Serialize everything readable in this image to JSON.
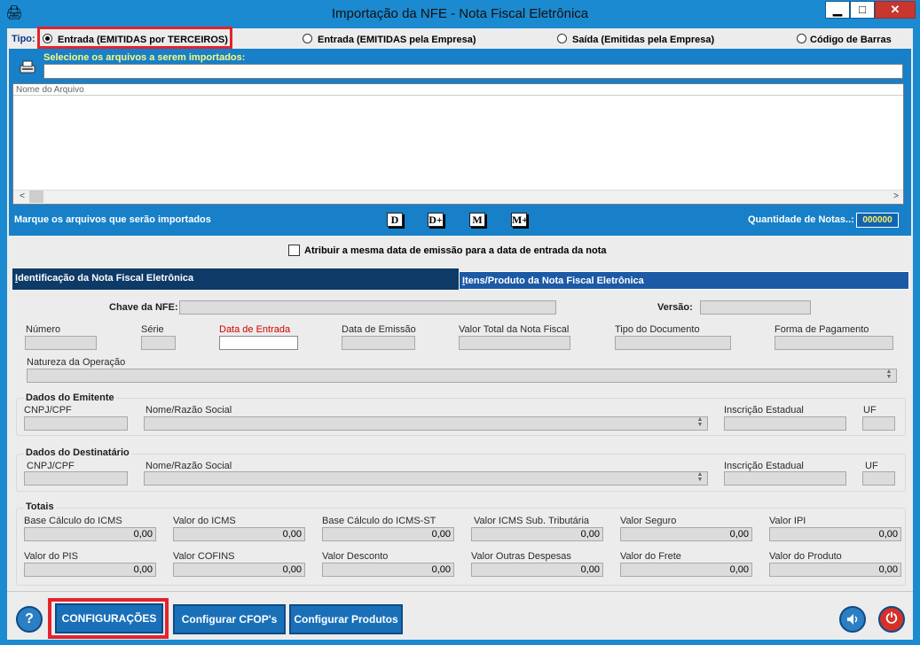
{
  "window": {
    "title": "Importação da NFE - Nota Fiscal Eletrônica",
    "min_label": "▁",
    "max_label": "□",
    "close_label": "✕"
  },
  "tipo": {
    "label": "Tipo:",
    "options": [
      {
        "label": "Entrada (EMITIDAS por TERCEIROS)",
        "selected": true
      },
      {
        "label": "Entrada (EMITIDAS pela Empresa)",
        "selected": false
      },
      {
        "label": "Saída (Emitidas pela Empresa)",
        "selected": false
      },
      {
        "label": "Código de Barras",
        "selected": false
      }
    ]
  },
  "files": {
    "select_label": "Selecione os arquivos a serem importados:",
    "input_value": "",
    "list_header": "Nome do Arquivo",
    "mark_label": "Marque os arquivos que serão importados",
    "mark_buttons": [
      "D",
      "D+",
      "M",
      "M+"
    ],
    "quantity_label": "Quantidade de Notas..:",
    "quantity_value": "000000"
  },
  "same_date_checkbox": {
    "label": "Atribuir a mesma data de emissão para a data de entrada da nota",
    "checked": false
  },
  "tabs": [
    {
      "label": "Identificação da Nota Fiscal Eletrônica",
      "active": true
    },
    {
      "label": "Itens/Produto da Nota Fiscal Eletrônica",
      "active": false
    }
  ],
  "ident": {
    "chave_label": "Chave da NFE:",
    "versao_label": "Versão:",
    "numero_label": "Número",
    "serie_label": "Série",
    "data_entrada_label": "Data de Entrada",
    "data_emissao_label": "Data de Emissão",
    "valor_total_label": "Valor Total da Nota Fiscal",
    "tipo_documento_label": "Tipo do Documento",
    "forma_pagamento_label": "Forma de Pagamento",
    "natureza_label": "Natureza da Operação"
  },
  "emitente": {
    "title": "Dados do Emitente",
    "cnpj_label": "CNPJ/CPF",
    "nome_label": "Nome/Razão Social",
    "ie_label": "Inscrição Estadual",
    "uf_label": "UF"
  },
  "destinatario": {
    "title": "Dados do Destinatário",
    "cnpj_label": "CNPJ/CPF",
    "nome_label": "Nome/Razão Social",
    "ie_label": "Inscrição Estadual",
    "uf_label": "UF"
  },
  "totais": {
    "title": "Totais",
    "row1": [
      {
        "label": "Base Cálculo do ICMS",
        "value": "0,00"
      },
      {
        "label": "Valor do ICMS",
        "value": "0,00"
      },
      {
        "label": "Base Cálculo do ICMS-ST",
        "value": "0,00"
      },
      {
        "label": "Valor ICMS Sub. Tributária",
        "value": "0,00"
      },
      {
        "label": "Valor Seguro",
        "value": "0,00"
      },
      {
        "label": "Valor IPI",
        "value": "0,00"
      }
    ],
    "row2": [
      {
        "label": "Valor do PIS",
        "value": "0,00"
      },
      {
        "label": "Valor COFINS",
        "value": "0,00"
      },
      {
        "label": "Valor Desconto",
        "value": "0,00"
      },
      {
        "label": "Valor Outras Despesas",
        "value": "0,00"
      },
      {
        "label": "Valor do Frete",
        "value": "0,00"
      },
      {
        "label": "Valor do Produto",
        "value": "0,00"
      }
    ]
  },
  "bottom": {
    "help": "?",
    "configuracoes": "CONFIGURAÇÕES",
    "configurar_cfop": "Configurar CFOP's",
    "configurar_produtos": "Configurar Produtos",
    "power": "⏻"
  },
  "colors": {
    "accent": "#1b8ad0",
    "panel": "#1780c8",
    "highlight": "#e4232b",
    "required_label": "#d40000"
  }
}
